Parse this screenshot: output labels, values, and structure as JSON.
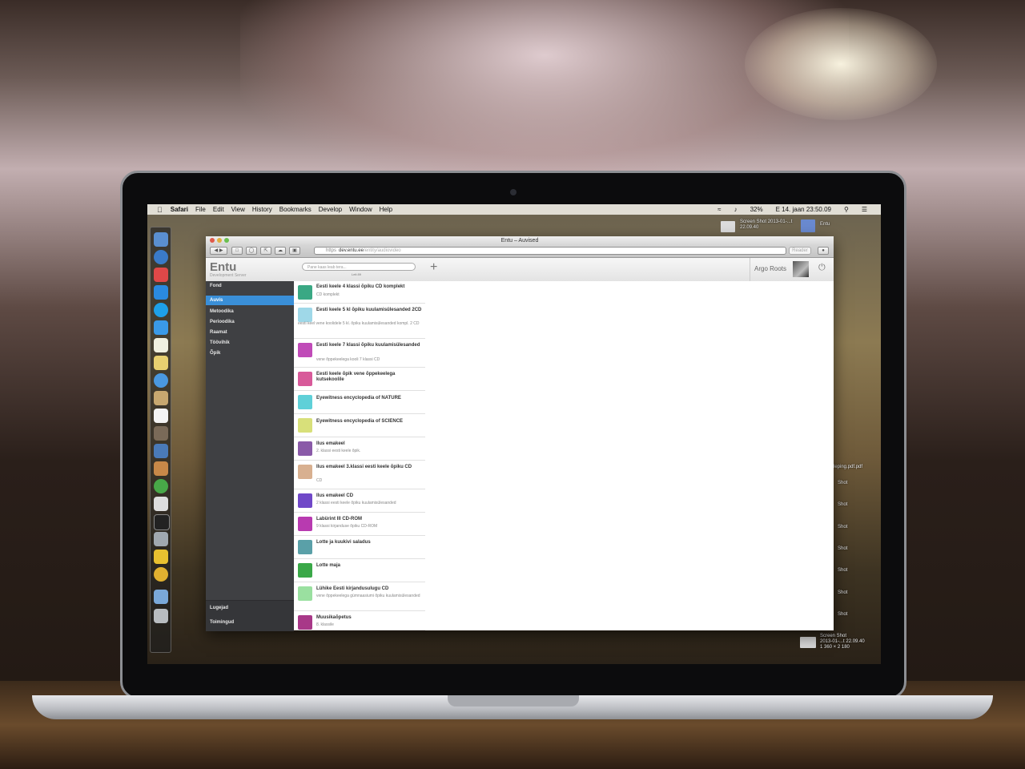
{
  "menubar": {
    "app": "Safari",
    "items": [
      "File",
      "Edit",
      "View",
      "History",
      "Bookmarks",
      "Develop",
      "Window",
      "Help"
    ],
    "battery": "32%",
    "datetime": "E 14. jaan  23:50.09"
  },
  "desktop": {
    "files": [
      {
        "name": "Screen Shot 2013-01-...t 22.09.40",
        "size": "1 360 × 2 180"
      },
      {
        "name": "Entu"
      }
    ],
    "labels": [
      "leping.pdf.pdf",
      "Shot",
      "Shot",
      "Shot",
      "Shot",
      "Shot",
      "Shot",
      "Shot"
    ],
    "bottom_file": {
      "line1": "Screen Shot",
      "line2": "2013-01-...t 22.09.40",
      "line3": "1 360 × 2 180"
    }
  },
  "browser": {
    "title": "Entu – Auvised",
    "url_scheme": "https",
    "url_host": "dev.entu.ee",
    "url_path": "/entity/audiovideo",
    "reader_label": "Reader"
  },
  "app": {
    "logo": "Entu",
    "subtitle": "Development Server",
    "search_placeholder": "Pane kaas leab tera...",
    "search_hint": "Leit 89",
    "user_name": "Argo Roots"
  },
  "sidebar": {
    "items": [
      {
        "label": "Fond",
        "active": false
      },
      {
        "label": "Auvis",
        "active": true
      },
      {
        "label": "Metoodika",
        "active": false
      },
      {
        "label": "Perioodika",
        "active": false
      },
      {
        "label": "Raamat",
        "active": false
      },
      {
        "label": "Töövihik",
        "active": false
      },
      {
        "label": "Õpik",
        "active": false
      }
    ],
    "bottom": [
      "Lugejad",
      "Toimingud"
    ]
  },
  "list": [
    {
      "title": "Eesti keele 4 klassi õpiku CD komplekt",
      "sub": "CD komplekt",
      "color": "#3aa884"
    },
    {
      "title": "Eesti keele 5 kl õpiku kuulamisülesanded 2CD",
      "sub": "eesti keel vene koolidele 5 kl. õpiku kuulamisülesanded kompl. 2 CD",
      "color": "#9fd8e8"
    },
    {
      "title": "Eesti keele 7 klassi õpiku kuulamisülesanded",
      "sub": "vene õppekeelega kooli 7 klassi CD",
      "color": "#c04bb8"
    },
    {
      "title": "Eesti keele õpik vene õppekeelega kutsekoolile",
      "sub": "",
      "color": "#d85a9a"
    },
    {
      "title": "Eyewitness encyclopedia of NATURE",
      "sub": "",
      "color": "#5fd0d8"
    },
    {
      "title": "Eyewitness encyclopedia of SCIENCE",
      "sub": "",
      "color": "#d8e07a"
    },
    {
      "title": "Ilus emakeel",
      "sub": "2. klassi eesti keele õpik.",
      "color": "#8a5aa8"
    },
    {
      "title": "Ilus emakeel 3.klassi eesti keele õpiku CD",
      "sub": "CD",
      "color": "#d8b090"
    },
    {
      "title": "Ilus emakeel CD",
      "sub": "2 klassi eesti keele õpiku kuulamisülesanded",
      "color": "#7048c8"
    },
    {
      "title": "Labürint III CD-ROM",
      "sub": "9 klassi kirjanduse õpiku CD-ROM",
      "color": "#b83ab0"
    },
    {
      "title": "Lotte ja kuukivi saladus",
      "sub": "",
      "color": "#5aa0a8"
    },
    {
      "title": "Lotte maja",
      "sub": "",
      "color": "#3aa848"
    },
    {
      "title": "Lühike Eesti kirjandusulugu CD",
      "sub": "vene õppekeelega gümnaasiumi õpiku kuulamisülesanded",
      "color": "#9ae0a0"
    },
    {
      "title": "Muusikaõpetus",
      "sub": "8. klassile",
      "color": "#a83888"
    }
  ]
}
